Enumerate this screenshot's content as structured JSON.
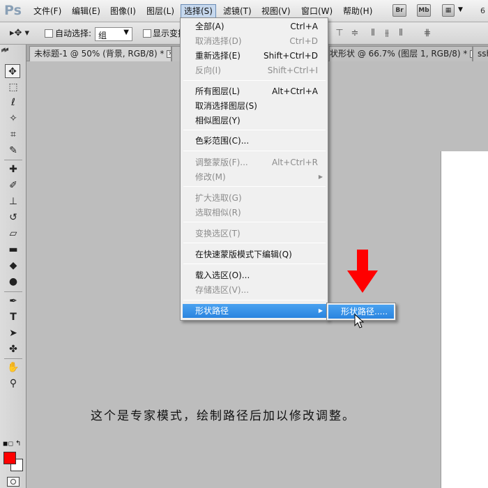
{
  "app": {
    "logo": "Ps"
  },
  "menubar": {
    "items": [
      "文件(F)",
      "编辑(E)",
      "图像(I)",
      "图层(L)",
      "选择(S)",
      "滤镜(T)",
      "视图(V)",
      "窗口(W)",
      "帮助(H)"
    ],
    "icons": [
      "Br",
      "Mb"
    ],
    "zoom": "6"
  },
  "options": {
    "auto_select_label": "自动选择:",
    "auto_select_value": "组",
    "show_transform_label": "显示变换"
  },
  "tabs": [
    {
      "label": "未标题-1 @ 50% (背景, RGB/8) *"
    },
    {
      "label": "状形状 @ 66.7% (图层 1, RGB/8) *"
    },
    {
      "label": "ssho"
    }
  ],
  "select_menu": {
    "items": [
      {
        "label": "全部(A)",
        "shortcut": "Ctrl+A",
        "disabled": false
      },
      {
        "label": "取消选择(D)",
        "shortcut": "Ctrl+D",
        "disabled": true
      },
      {
        "label": "重新选择(E)",
        "shortcut": "Shift+Ctrl+D",
        "disabled": false
      },
      {
        "label": "反向(I)",
        "shortcut": "Shift+Ctrl+I",
        "disabled": true
      },
      {
        "label": "所有图层(L)",
        "shortcut": "Alt+Ctrl+A",
        "disabled": false
      },
      {
        "label": "取消选择图层(S)",
        "shortcut": "",
        "disabled": false
      },
      {
        "label": "相似图层(Y)",
        "shortcut": "",
        "disabled": false
      },
      {
        "label": "色彩范围(C)...",
        "shortcut": "",
        "disabled": false
      },
      {
        "label": "调整蒙版(F)...",
        "shortcut": "Alt+Ctrl+R",
        "disabled": true
      },
      {
        "label": "修改(M)",
        "shortcut": "",
        "disabled": true
      },
      {
        "label": "扩大选取(G)",
        "shortcut": "",
        "disabled": true
      },
      {
        "label": "选取相似(R)",
        "shortcut": "",
        "disabled": true
      },
      {
        "label": "变换选区(T)",
        "shortcut": "",
        "disabled": true
      },
      {
        "label": "在快速蒙版模式下编辑(Q)",
        "shortcut": "",
        "disabled": false
      },
      {
        "label": "载入选区(O)...",
        "shortcut": "",
        "disabled": false
      },
      {
        "label": "存储选区(V)...",
        "shortcut": "",
        "disabled": true
      },
      {
        "label": "形状路径",
        "shortcut": "",
        "disabled": false,
        "highlighted": true
      }
    ]
  },
  "submenu": {
    "item": "形状路径....."
  },
  "caption": "这个是专家模式，绘制路径后加以修改调整。",
  "colors": {
    "foreground": "#ff0000",
    "background": "#ffffff",
    "highlight": "#3a94e8",
    "annotation_arrow": "#ff0000"
  }
}
